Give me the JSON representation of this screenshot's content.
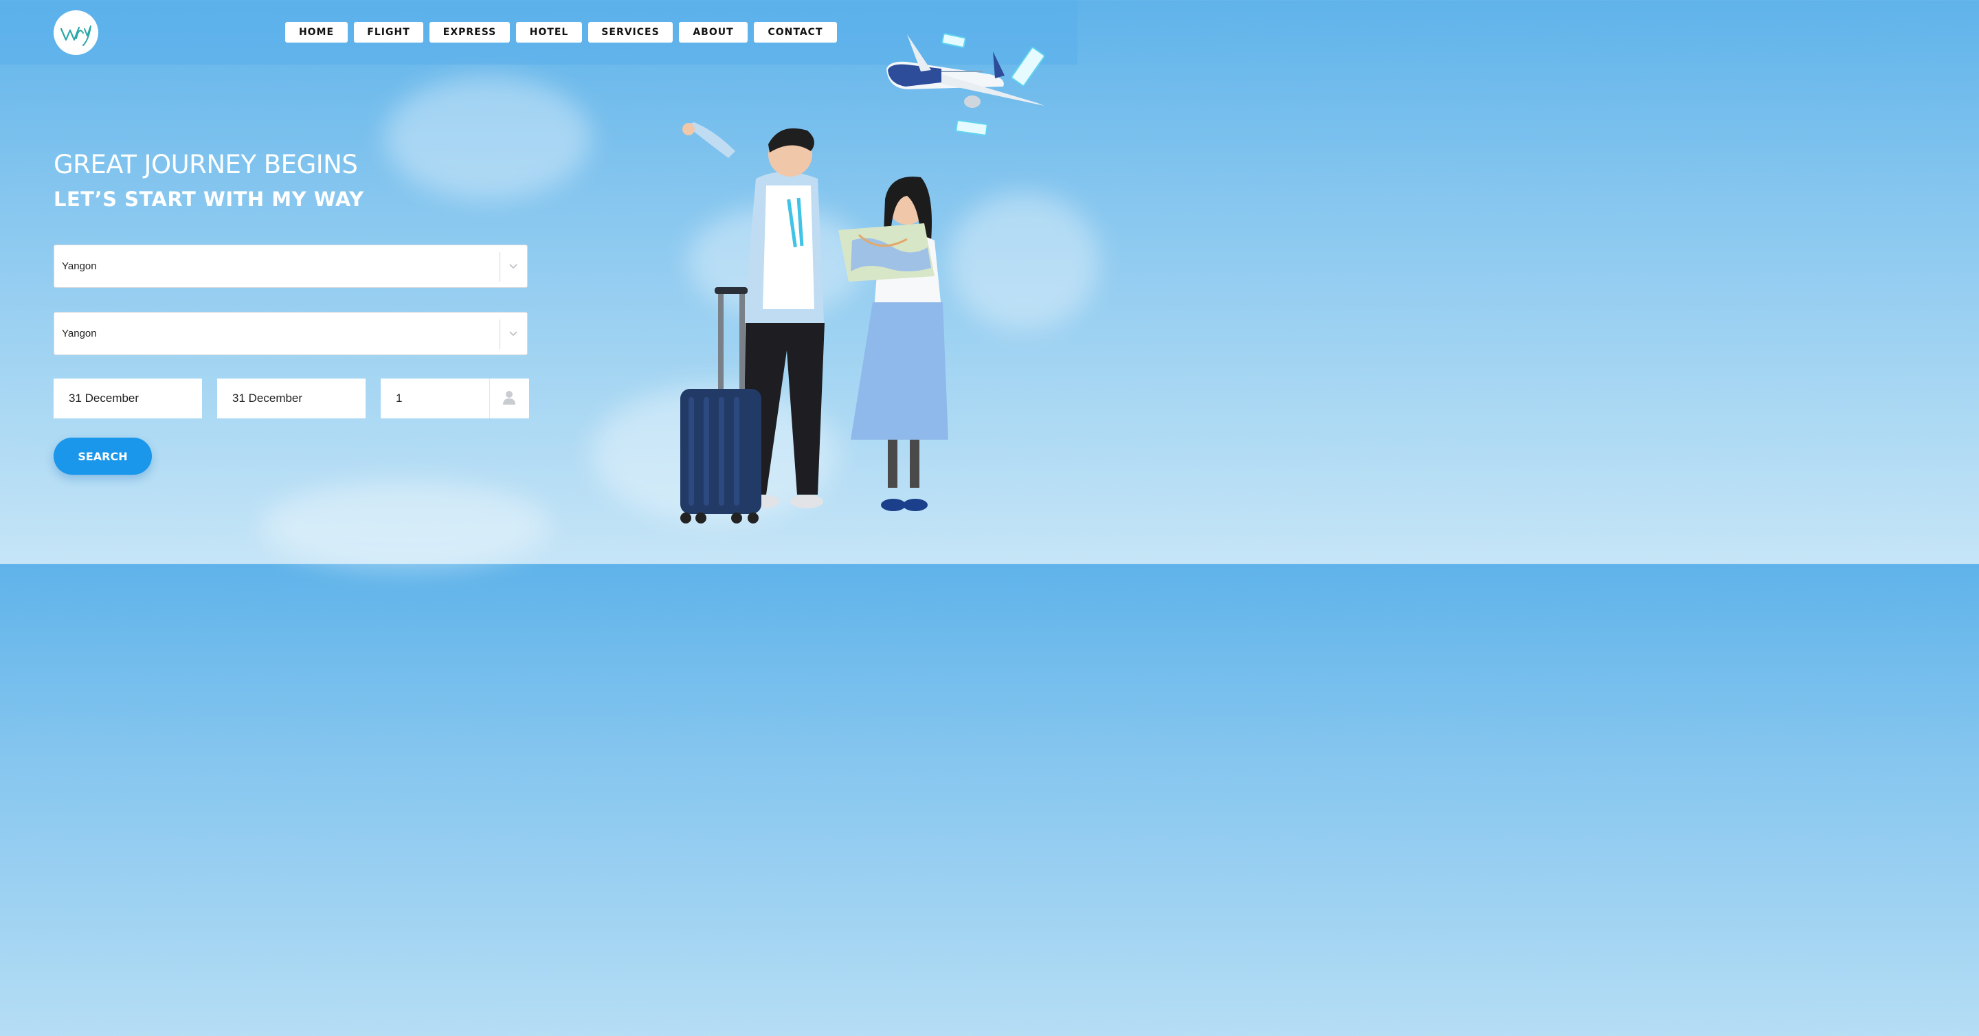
{
  "brand": {
    "logo_text": "Way",
    "accent": "#1a96ea",
    "teal": "#2aa7a7"
  },
  "nav": {
    "items": [
      {
        "label": "HOME"
      },
      {
        "label": "FLIGHT"
      },
      {
        "label": "EXPRESS"
      },
      {
        "label": "HOTEL"
      },
      {
        "label": "SERVICES"
      },
      {
        "label": "ABOUT"
      },
      {
        "label": "CONTACT"
      }
    ]
  },
  "hero": {
    "title": "GREAT JOURNEY BEGINS",
    "subtitle": "LET’S START WITH MY WAY"
  },
  "search_form": {
    "from": {
      "value": "Yangon",
      "icon": "chevron-down-icon"
    },
    "to": {
      "value": "Yangon",
      "icon": "chevron-down-icon"
    },
    "depart_date": "31 December",
    "return_date": "31 December",
    "passengers": {
      "value": "1",
      "icon": "person-icon"
    },
    "search_label": "SEARCH"
  }
}
